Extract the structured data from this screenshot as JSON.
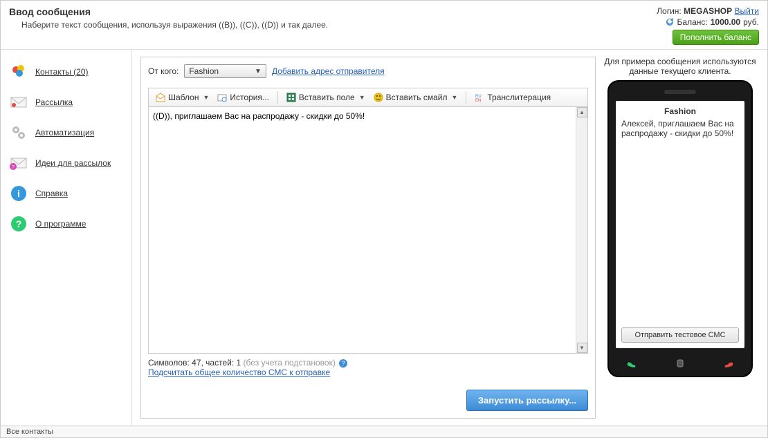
{
  "header": {
    "title": "Ввод сообщения",
    "subtitle": "Наберите текст сообщения, используя выражения ((B)), ((C)), ((D)) и так далее.",
    "login_label": "Логин:",
    "login_value": "MEGASHOP",
    "logout": "Выйти",
    "balance_label": "Баланс:",
    "balance_value": "1000.00",
    "balance_unit": "руб.",
    "topup_button": "Пополнить баланс"
  },
  "sidebar": {
    "items": [
      {
        "label": "Контакты (20)"
      },
      {
        "label": "Рассылка"
      },
      {
        "label": "Автоматизация"
      },
      {
        "label": "Идеи для рассылок"
      },
      {
        "label": "Справка"
      },
      {
        "label": "О программе"
      }
    ]
  },
  "main": {
    "from_label": "От кого:",
    "from_value": "Fashion",
    "add_sender_link": "Добавить адрес отправителя",
    "toolbar": {
      "template": "Шаблон",
      "history": "История...",
      "insert_field": "Вставить поле",
      "insert_smile": "Вставить смайл",
      "translit": "Транслитерация"
    },
    "message_text": "((D)), приглашаем Вас на распродажу - скидки до 50%!",
    "stats": {
      "chars_label": "Символов:",
      "chars": "47",
      "parts_label": "частей:",
      "parts": "1",
      "note": "(без учета подстановок)",
      "calc_link": "Подсчитать общее количество СМС к отправке"
    },
    "run_button": "Запустить рассылку..."
  },
  "preview": {
    "note": "Для примера сообщения используются данные текущего клиента.",
    "title": "Fashion",
    "body": "Алексей, приглашаем Вас на распродажу - скидки до 50%!",
    "send_test": "Отправить тестовое СМС"
  },
  "footer": {
    "status": "Все контакты"
  }
}
